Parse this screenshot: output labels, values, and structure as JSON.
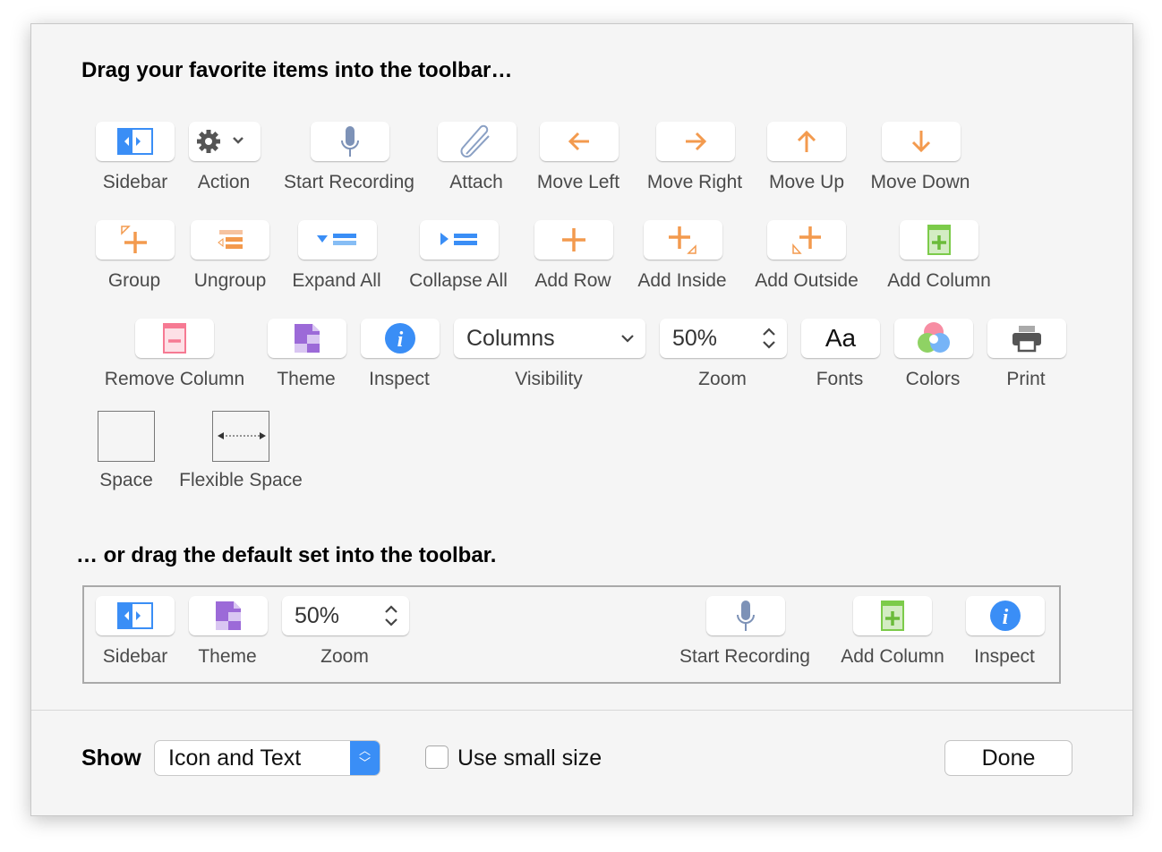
{
  "headings": {
    "favorites": "Drag your favorite items into the toolbar…",
    "default_set": "… or drag the default set into the toolbar."
  },
  "palette": [
    {
      "label": "Sidebar",
      "icon": "sidebar-icon"
    },
    {
      "label": "Action",
      "icon": "gear-icon"
    },
    {
      "label": "Start Recording",
      "icon": "microphone-icon"
    },
    {
      "label": "Attach",
      "icon": "paperclip-icon"
    },
    {
      "label": "Move Left",
      "icon": "arrow-left-icon"
    },
    {
      "label": "Move Right",
      "icon": "arrow-right-icon"
    },
    {
      "label": "Move Up",
      "icon": "arrow-up-icon"
    },
    {
      "label": "Move Down",
      "icon": "arrow-down-icon"
    },
    {
      "label": "Group",
      "icon": "group-icon"
    },
    {
      "label": "Ungroup",
      "icon": "ungroup-icon"
    },
    {
      "label": "Expand All",
      "icon": "expand-all-icon"
    },
    {
      "label": "Collapse All",
      "icon": "collapse-all-icon"
    },
    {
      "label": "Add Row",
      "icon": "plus-icon"
    },
    {
      "label": "Add Inside",
      "icon": "add-inside-icon"
    },
    {
      "label": "Add Outside",
      "icon": "add-outside-icon"
    },
    {
      "label": "Add Column",
      "icon": "add-column-icon"
    },
    {
      "label": "Remove Column",
      "icon": "remove-column-icon"
    },
    {
      "label": "Theme",
      "icon": "theme-icon"
    },
    {
      "label": "Inspect",
      "icon": "info-icon"
    },
    {
      "label": "Visibility",
      "icon": "popup",
      "value": "Columns"
    },
    {
      "label": "Zoom",
      "icon": "stepper",
      "value": "50%"
    },
    {
      "label": "Fonts",
      "icon": "fonts-icon",
      "value": "Aa"
    },
    {
      "label": "Colors",
      "icon": "color-wheel-icon"
    },
    {
      "label": "Print",
      "icon": "printer-icon"
    },
    {
      "label": "Space",
      "icon": "space-icon"
    },
    {
      "label": "Flexible Space",
      "icon": "flexible-space-icon"
    }
  ],
  "default_set": [
    {
      "label": "Sidebar",
      "icon": "sidebar-icon"
    },
    {
      "label": "Theme",
      "icon": "theme-icon"
    },
    {
      "label": "Zoom",
      "icon": "stepper",
      "value": "50%"
    },
    {
      "label": "Start Recording",
      "icon": "microphone-icon"
    },
    {
      "label": "Add Column",
      "icon": "add-column-icon"
    },
    {
      "label": "Inspect",
      "icon": "info-icon"
    }
  ],
  "footer": {
    "show_label": "Show",
    "show_value": "Icon and Text",
    "small_size_label": "Use small size",
    "small_size_checked": false,
    "done_label": "Done"
  },
  "colors": {
    "orange": "#f39a4e",
    "blue": "#3a8ef6",
    "green": "#7ccb4a",
    "pink": "#f67a93",
    "purple": "#9c6ad8"
  }
}
